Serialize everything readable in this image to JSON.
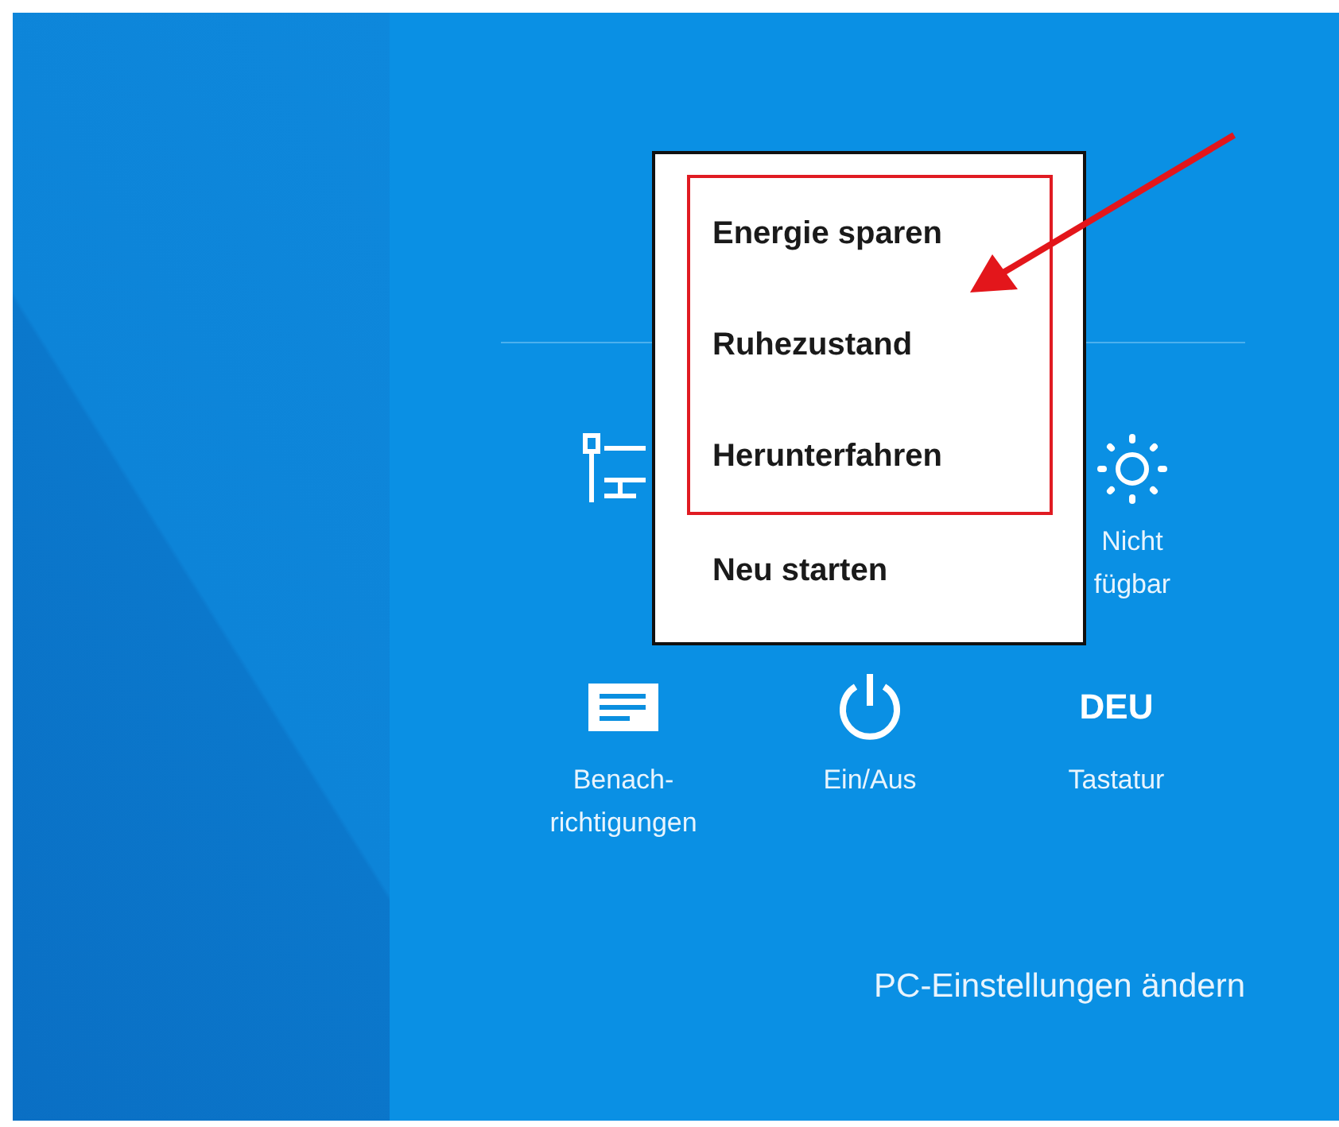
{
  "power_menu": {
    "items": [
      {
        "label": "Energie sparen",
        "marked": true
      },
      {
        "label": "Ruhezustand",
        "marked": true
      },
      {
        "label": "Herunterfahren",
        "marked": true
      },
      {
        "label": "Neu starten",
        "marked": false
      }
    ]
  },
  "settings_tiles": [
    {
      "kind": "network"
    },
    {
      "kind": "brightness",
      "lines": [
        "Nicht",
        "fügbar"
      ]
    },
    {
      "kind": "notifications",
      "lines": [
        "Benach-",
        "richtigungen"
      ]
    },
    {
      "kind": "power",
      "lines": [
        "Ein/Aus"
      ]
    },
    {
      "kind": "keyboard",
      "symbol": "DEU",
      "lines": [
        "Tastatur"
      ]
    }
  ],
  "footer_link": "PC-Einstellungen ändern"
}
